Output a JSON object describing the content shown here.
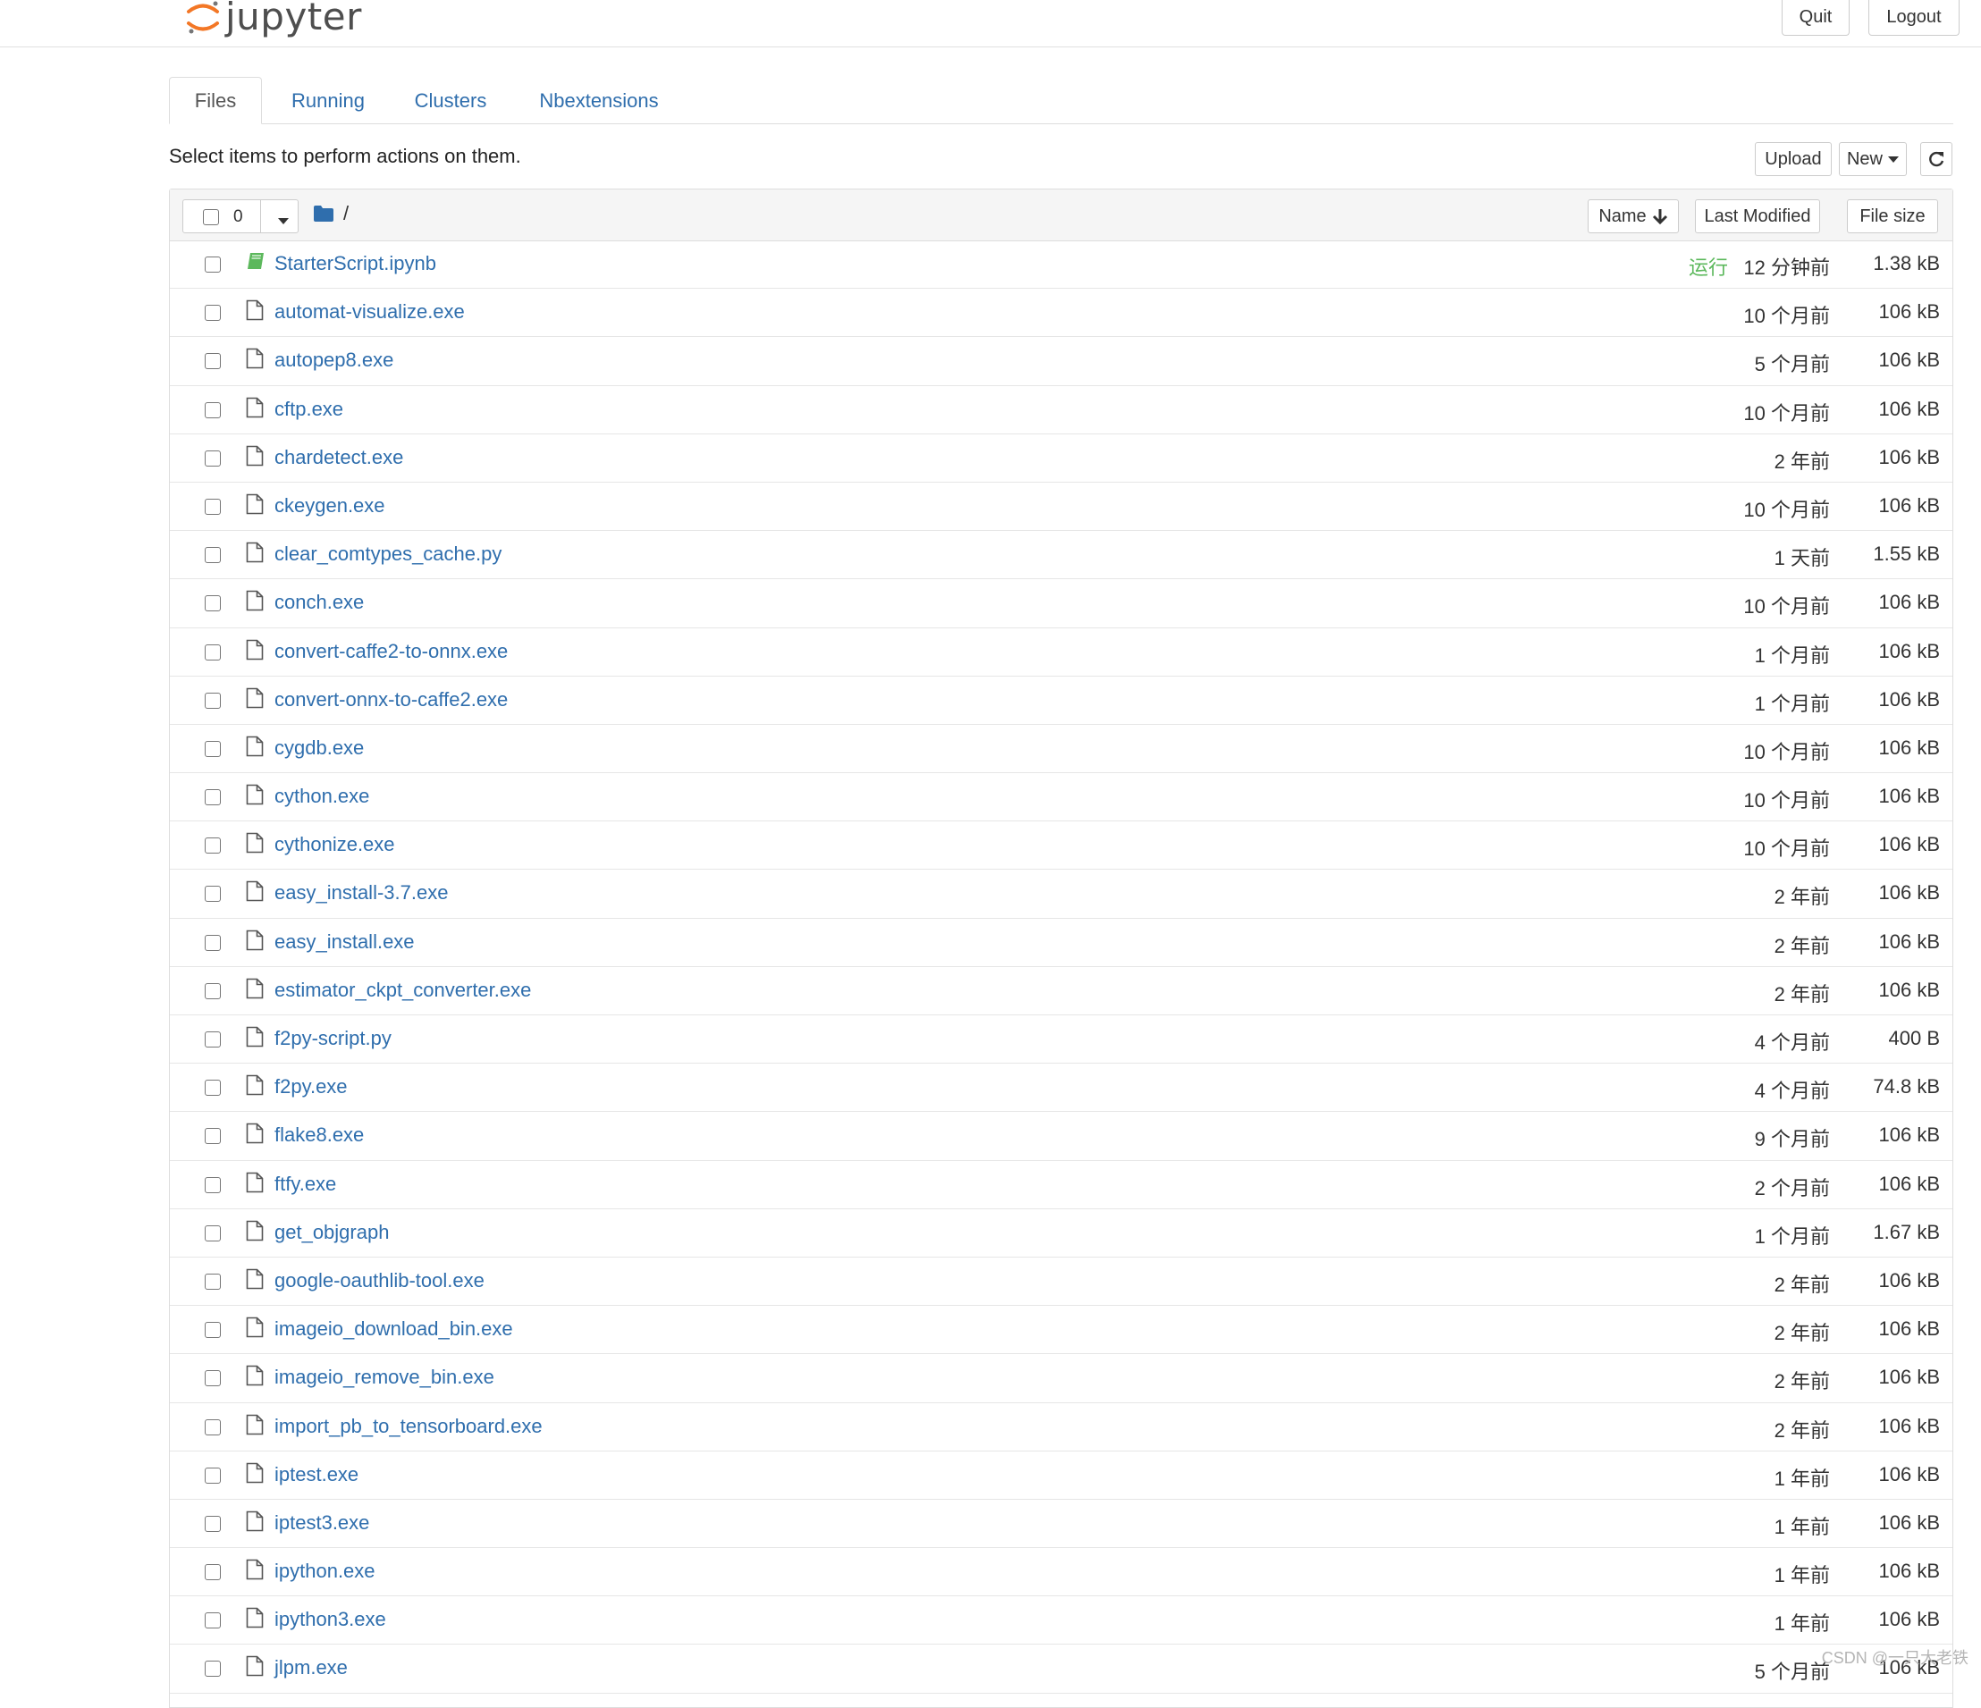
{
  "header": {
    "logo_text": "jupyter",
    "quit_label": "Quit",
    "logout_label": "Logout"
  },
  "tabs": [
    {
      "label": "Files",
      "active": true
    },
    {
      "label": "Running",
      "active": false
    },
    {
      "label": "Clusters",
      "active": false
    },
    {
      "label": "Nbextensions",
      "active": false
    }
  ],
  "toolbar": {
    "hint": "Select items to perform actions on them.",
    "upload_label": "Upload",
    "new_label": "New",
    "refresh_icon": "refresh-icon"
  },
  "list_header": {
    "selected_count": "0",
    "breadcrumb": "/",
    "sort_name_label": "Name",
    "sort_modified_label": "Last Modified",
    "sort_size_label": "File size"
  },
  "colors": {
    "link": "#2f6ead",
    "running": "#5cb85c",
    "logo_orange": "#f37726"
  },
  "files": [
    {
      "name": "StarterScript.ipynb",
      "icon": "notebook-icon",
      "status": "运行",
      "modified": "12 分钟前",
      "size": "1.38 kB"
    },
    {
      "name": "automat-visualize.exe",
      "icon": "file-icon",
      "status": "",
      "modified": "10 个月前",
      "size": "106 kB"
    },
    {
      "name": "autopep8.exe",
      "icon": "file-icon",
      "status": "",
      "modified": "5 个月前",
      "size": "106 kB"
    },
    {
      "name": "cftp.exe",
      "icon": "file-icon",
      "status": "",
      "modified": "10 个月前",
      "size": "106 kB"
    },
    {
      "name": "chardetect.exe",
      "icon": "file-icon",
      "status": "",
      "modified": "2 年前",
      "size": "106 kB"
    },
    {
      "name": "ckeygen.exe",
      "icon": "file-icon",
      "status": "",
      "modified": "10 个月前",
      "size": "106 kB"
    },
    {
      "name": "clear_comtypes_cache.py",
      "icon": "file-icon",
      "status": "",
      "modified": "1 天前",
      "size": "1.55 kB"
    },
    {
      "name": "conch.exe",
      "icon": "file-icon",
      "status": "",
      "modified": "10 个月前",
      "size": "106 kB"
    },
    {
      "name": "convert-caffe2-to-onnx.exe",
      "icon": "file-icon",
      "status": "",
      "modified": "1 个月前",
      "size": "106 kB"
    },
    {
      "name": "convert-onnx-to-caffe2.exe",
      "icon": "file-icon",
      "status": "",
      "modified": "1 个月前",
      "size": "106 kB"
    },
    {
      "name": "cygdb.exe",
      "icon": "file-icon",
      "status": "",
      "modified": "10 个月前",
      "size": "106 kB"
    },
    {
      "name": "cython.exe",
      "icon": "file-icon",
      "status": "",
      "modified": "10 个月前",
      "size": "106 kB"
    },
    {
      "name": "cythonize.exe",
      "icon": "file-icon",
      "status": "",
      "modified": "10 个月前",
      "size": "106 kB"
    },
    {
      "name": "easy_install-3.7.exe",
      "icon": "file-icon",
      "status": "",
      "modified": "2 年前",
      "size": "106 kB"
    },
    {
      "name": "easy_install.exe",
      "icon": "file-icon",
      "status": "",
      "modified": "2 年前",
      "size": "106 kB"
    },
    {
      "name": "estimator_ckpt_converter.exe",
      "icon": "file-icon",
      "status": "",
      "modified": "2 年前",
      "size": "106 kB"
    },
    {
      "name": "f2py-script.py",
      "icon": "file-icon",
      "status": "",
      "modified": "4 个月前",
      "size": "400 B"
    },
    {
      "name": "f2py.exe",
      "icon": "file-icon",
      "status": "",
      "modified": "4 个月前",
      "size": "74.8 kB"
    },
    {
      "name": "flake8.exe",
      "icon": "file-icon",
      "status": "",
      "modified": "9 个月前",
      "size": "106 kB"
    },
    {
      "name": "ftfy.exe",
      "icon": "file-icon",
      "status": "",
      "modified": "2 个月前",
      "size": "106 kB"
    },
    {
      "name": "get_objgraph",
      "icon": "file-icon",
      "status": "",
      "modified": "1 个月前",
      "size": "1.67 kB"
    },
    {
      "name": "google-oauthlib-tool.exe",
      "icon": "file-icon",
      "status": "",
      "modified": "2 年前",
      "size": "106 kB"
    },
    {
      "name": "imageio_download_bin.exe",
      "icon": "file-icon",
      "status": "",
      "modified": "2 年前",
      "size": "106 kB"
    },
    {
      "name": "imageio_remove_bin.exe",
      "icon": "file-icon",
      "status": "",
      "modified": "2 年前",
      "size": "106 kB"
    },
    {
      "name": "import_pb_to_tensorboard.exe",
      "icon": "file-icon",
      "status": "",
      "modified": "2 年前",
      "size": "106 kB"
    },
    {
      "name": "iptest.exe",
      "icon": "file-icon",
      "status": "",
      "modified": "1 年前",
      "size": "106 kB"
    },
    {
      "name": "iptest3.exe",
      "icon": "file-icon",
      "status": "",
      "modified": "1 年前",
      "size": "106 kB"
    },
    {
      "name": "ipython.exe",
      "icon": "file-icon",
      "status": "",
      "modified": "1 年前",
      "size": "106 kB"
    },
    {
      "name": "ipython3.exe",
      "icon": "file-icon",
      "status": "",
      "modified": "1 年前",
      "size": "106 kB"
    },
    {
      "name": "jlpm.exe",
      "icon": "file-icon",
      "status": "",
      "modified": "5 个月前",
      "size": "106 kB"
    }
  ],
  "watermark": "CSDN @一只大老铁"
}
